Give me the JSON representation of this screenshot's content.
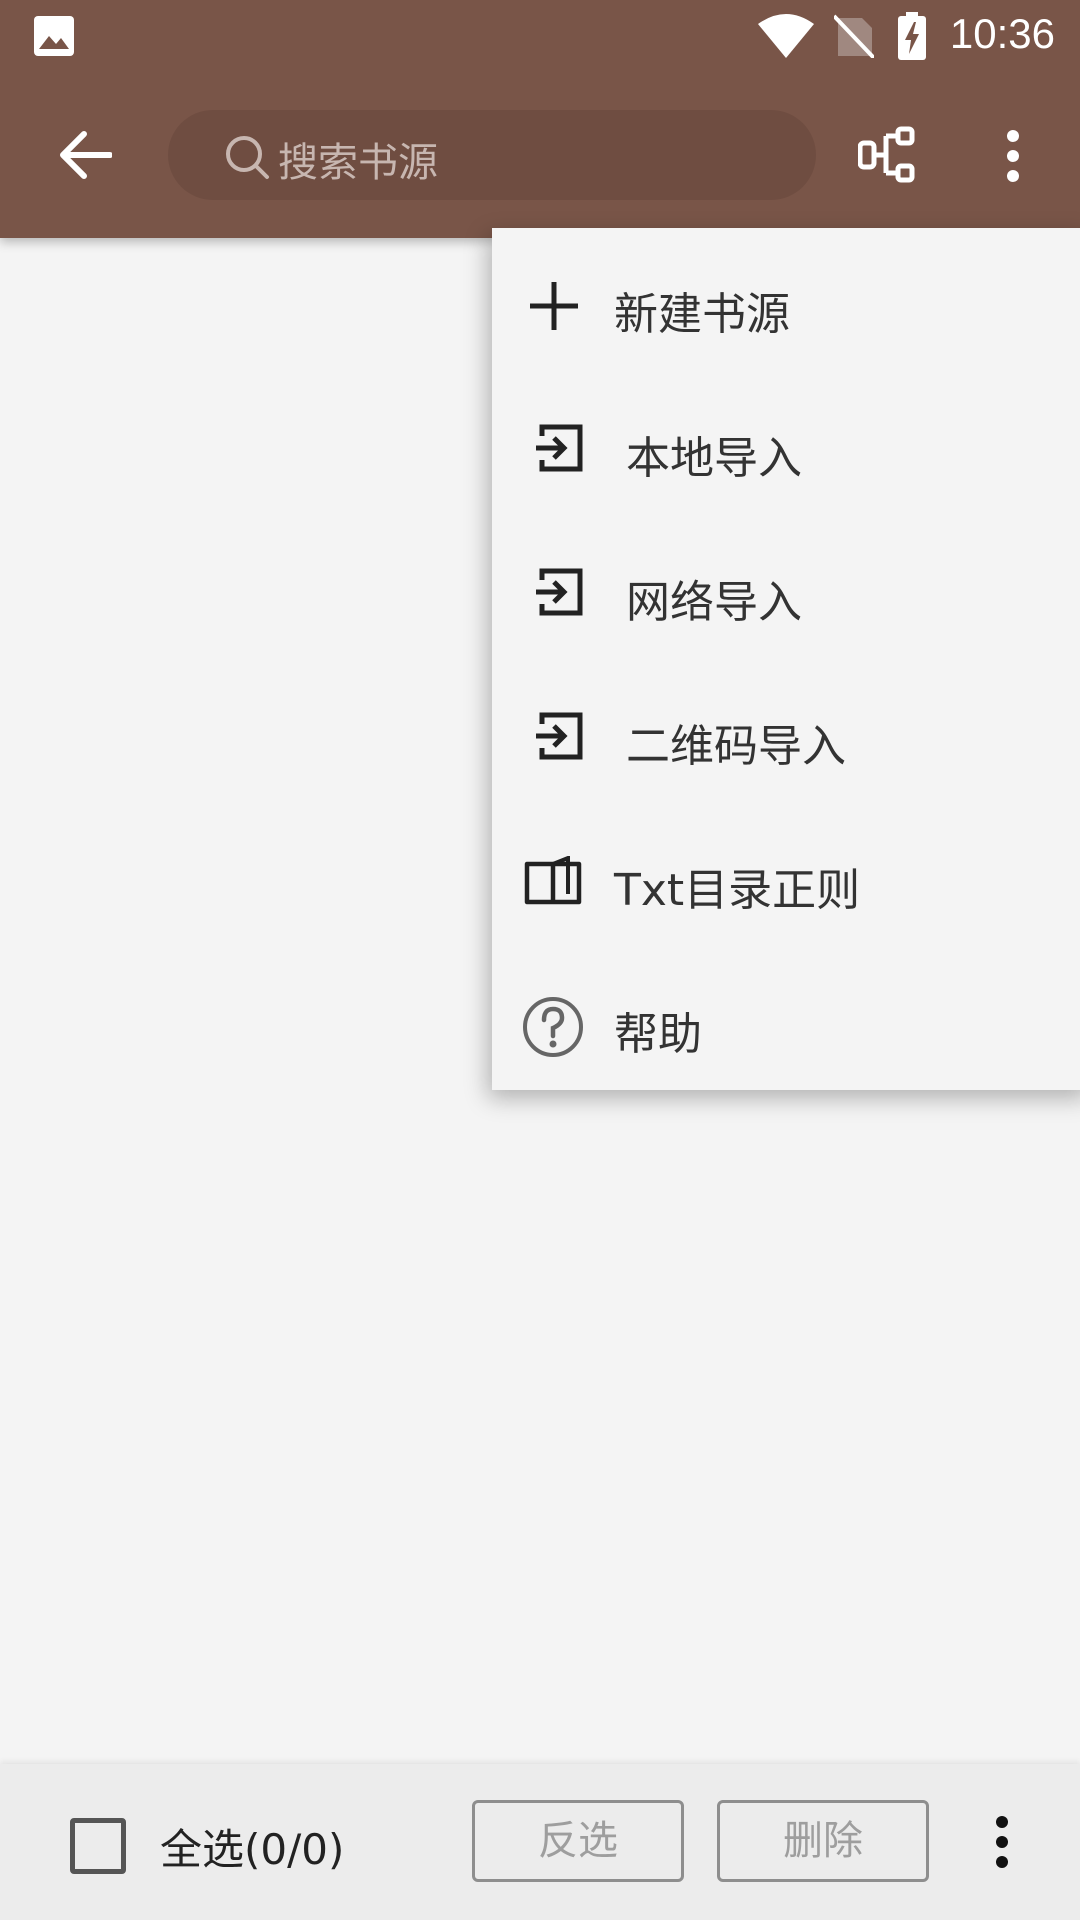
{
  "status_bar": {
    "time": "10:36"
  },
  "toolbar": {
    "search_placeholder": "搜索书源"
  },
  "menu": {
    "items": [
      {
        "label": "新建书源",
        "icon": "plus-icon"
      },
      {
        "label": "本地导入",
        "icon": "import-icon"
      },
      {
        "label": "网络导入",
        "icon": "import-icon"
      },
      {
        "label": "二维码导入",
        "icon": "import-icon"
      },
      {
        "label": "Txt目录正则",
        "icon": "book-open-icon"
      },
      {
        "label": "帮助",
        "icon": "help-circle-icon"
      }
    ]
  },
  "bottom_bar": {
    "select_all_label": "全选(0/0)",
    "invert_label": "反选",
    "delete_label": "删除"
  },
  "colors": {
    "app_bar": "#795548",
    "search_bg": "#6f4d41",
    "menu_bg": "#f4f4f4",
    "background": "#f4f4f4"
  }
}
